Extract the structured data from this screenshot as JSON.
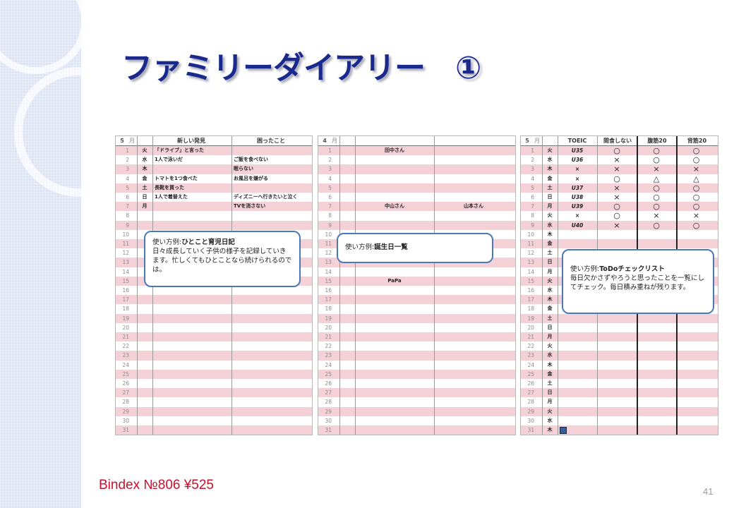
{
  "slide": {
    "title": "ファミリーダイアリー　①",
    "product": "Bindex №806 ¥525",
    "page_number": "41"
  },
  "sheets": {
    "sheet1": {
      "month": "5",
      "month_unit": "月",
      "headers": [
        "新しい発見",
        "困ったこと"
      ],
      "days": [
        "火",
        "水",
        "木",
        "金",
        "土",
        "日",
        "月"
      ],
      "entries": [
        [
          "「ドライブ」と言った",
          ""
        ],
        [
          "1人で泳いだ",
          "ご飯を食べない"
        ],
        [
          "",
          "眠らない"
        ],
        [
          "トマトを1つ食べた",
          "お風呂を嫌がる"
        ],
        [
          "長靴を買った",
          ""
        ],
        [
          "1人で着替えた",
          "ディズニーへ行きたいと泣く"
        ],
        [
          "",
          "TVを消さない"
        ]
      ]
    },
    "sheet2": {
      "month": "4",
      "month_unit": "月",
      "entries": [
        {
          "day": 1,
          "text": "田中さん",
          "col": 1
        },
        {
          "day": 7,
          "text": "中山さん",
          "col": 1
        },
        {
          "day": 7,
          "text": "山本さん",
          "col": 2
        },
        {
          "day": 15,
          "text": "PaPa",
          "col": 1
        }
      ]
    },
    "sheet3": {
      "month": "5",
      "month_unit": "月",
      "headers": [
        "TOEIC",
        "間食しない",
        "腹筋20",
        "背筋20"
      ],
      "days": [
        "火",
        "水",
        "木",
        "金",
        "土",
        "日",
        "月",
        "火",
        "水",
        "木",
        "金",
        "土",
        "日",
        "月",
        "火",
        "水",
        "木",
        "金",
        "土",
        "日",
        "月",
        "火",
        "水",
        "木",
        "金",
        "土",
        "日",
        "月",
        "火",
        "水",
        "木"
      ],
      "rows": [
        [
          "U35",
          "○",
          "○",
          "○"
        ],
        [
          "U36",
          "×",
          "○",
          "○"
        ],
        [
          "×",
          "×",
          "×",
          "×"
        ],
        [
          "×",
          "○",
          "△",
          "△"
        ],
        [
          "U37",
          "×",
          "○",
          "○"
        ],
        [
          "U38",
          "×",
          "○",
          "○"
        ],
        [
          "U39",
          "○",
          "○",
          "○"
        ],
        [
          "×",
          "○",
          "×",
          "×"
        ],
        [
          "U40",
          "×",
          "○",
          "○"
        ]
      ]
    }
  },
  "callouts": {
    "c1": {
      "label": "使い方例:",
      "title": "ひとこと育児日記",
      "body": "日々成長していく子供の様子を記録していきます。忙しくてもひとことなら続けられるのでは。"
    },
    "c2": {
      "label": "使い方例:",
      "title": "誕生日一覧",
      "body": ""
    },
    "c3": {
      "label": "使い方例:",
      "title": "ToDoチェックリスト",
      "body": "毎日欠かさずやろうと思ったことを一覧にしてチェック。毎日積み重ねが残ります。"
    }
  },
  "colors": {
    "stripe": "#f3d1d6",
    "title": "#1a2a8c",
    "callout_border": "#4a78b8",
    "product_text": "#c8102e"
  }
}
